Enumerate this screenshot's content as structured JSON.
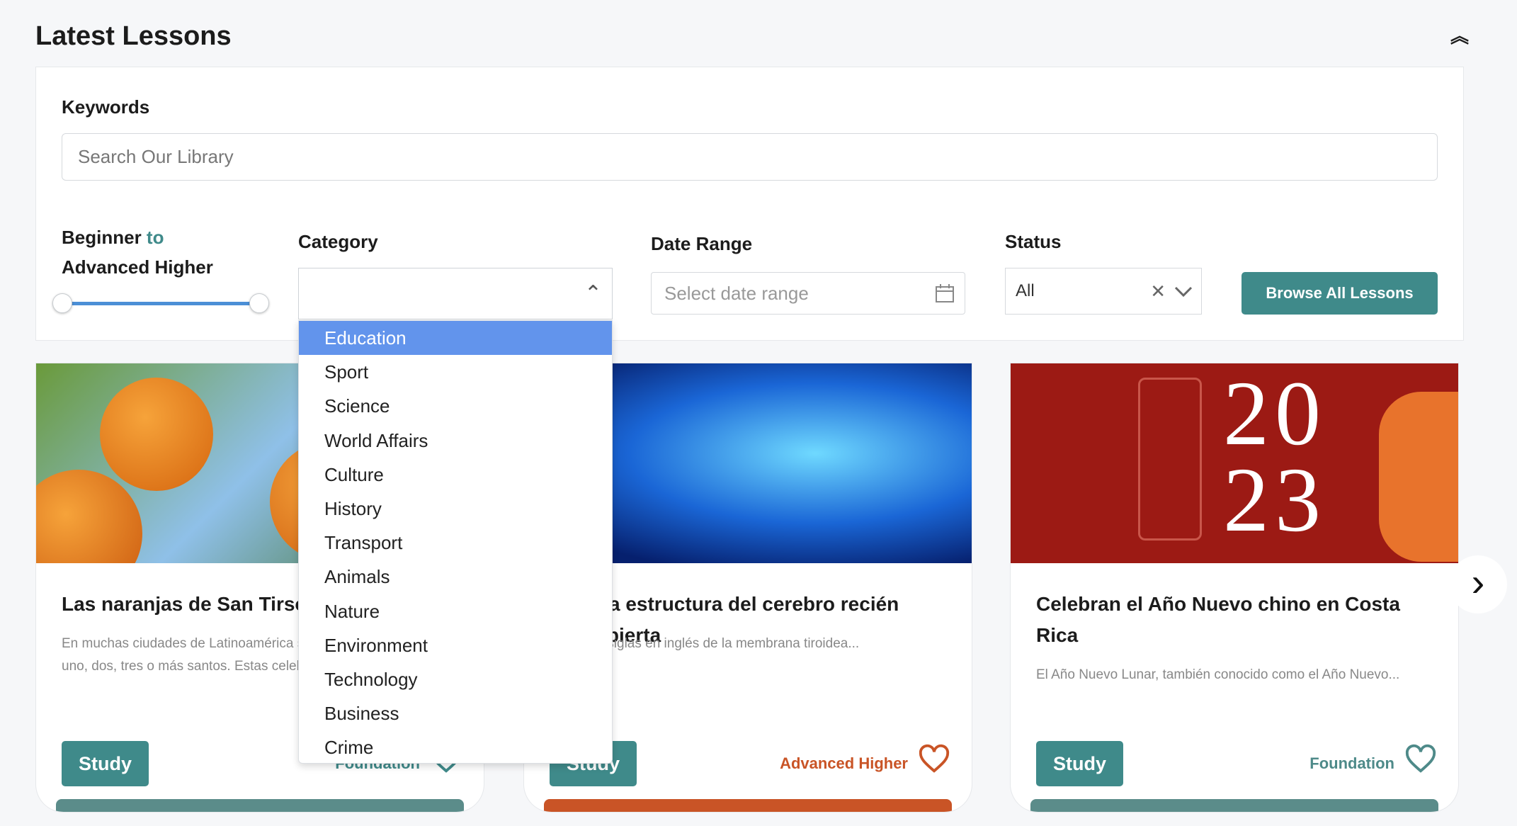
{
  "header": {
    "title": "Latest Lessons",
    "collapse_icon": "double-chevron-up-icon"
  },
  "filters": {
    "keywords_label": "Keywords",
    "search_placeholder": "Search Our Library",
    "level_label_start": "Beginner",
    "level_label_to": "to",
    "level_label_end": "Advanced Higher",
    "level_range": {
      "min_fraction": 0,
      "max_fraction": 1
    },
    "category_label": "Category",
    "category_value": "",
    "category_options": [
      "Education",
      "Sport",
      "Science",
      "World Affairs",
      "Culture",
      "History",
      "Transport",
      "Animals",
      "Nature",
      "Environment",
      "Technology",
      "Business",
      "Crime"
    ],
    "category_highlighted": "Education",
    "date_label": "Date Range",
    "date_placeholder": "Select date range",
    "status_label": "Status",
    "status_value": "All",
    "browse_button": "Browse All Lessons"
  },
  "cards": [
    {
      "title": "Las naranjas de San Tirso",
      "description": "En muchas ciudades de Latinoamérica se celebran fiestas para uno, dos, tres o más santos. Estas celebraciones también...",
      "study": "Study",
      "level": "Foundation",
      "level_color": "#3f8a8a",
      "bar_color": "#5b8c8a"
    },
    {
      "title": "DTM, la estructura del cerebro recién descubierta",
      "description": "DTM, las siglas en inglés de la membrana tiroidea...",
      "study": "Study",
      "level": "Advanced Higher",
      "level_color": "#c95426",
      "bar_color": "#c95426"
    },
    {
      "title": "Celebran el Año Nuevo chino en Costa Rica",
      "description": "El Año Nuevo Lunar, también conocido como el Año Nuevo...",
      "study": "Study",
      "level": "Foundation",
      "level_color": "#4e8a89",
      "bar_color": "#5b8c8a"
    }
  ],
  "colors": {
    "accent": "#3f8a8a",
    "highlight": "#6294ec"
  }
}
